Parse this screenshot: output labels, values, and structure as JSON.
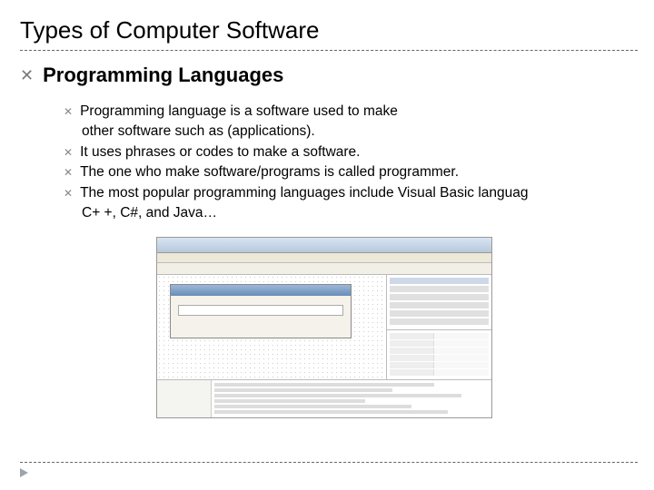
{
  "title": "Types of Computer Software",
  "heading": "Programming Languages",
  "bullet_glyph": "✕",
  "bullets": [
    "Programming language is a software used to make",
    "other software such as (applications).",
    "It uses phrases or codes to make a software.",
    "The one who make software/programs is called programmer.",
    "The most popular programming languages include Visual Basic languag",
    "C+ +,  C#, and Java…"
  ]
}
